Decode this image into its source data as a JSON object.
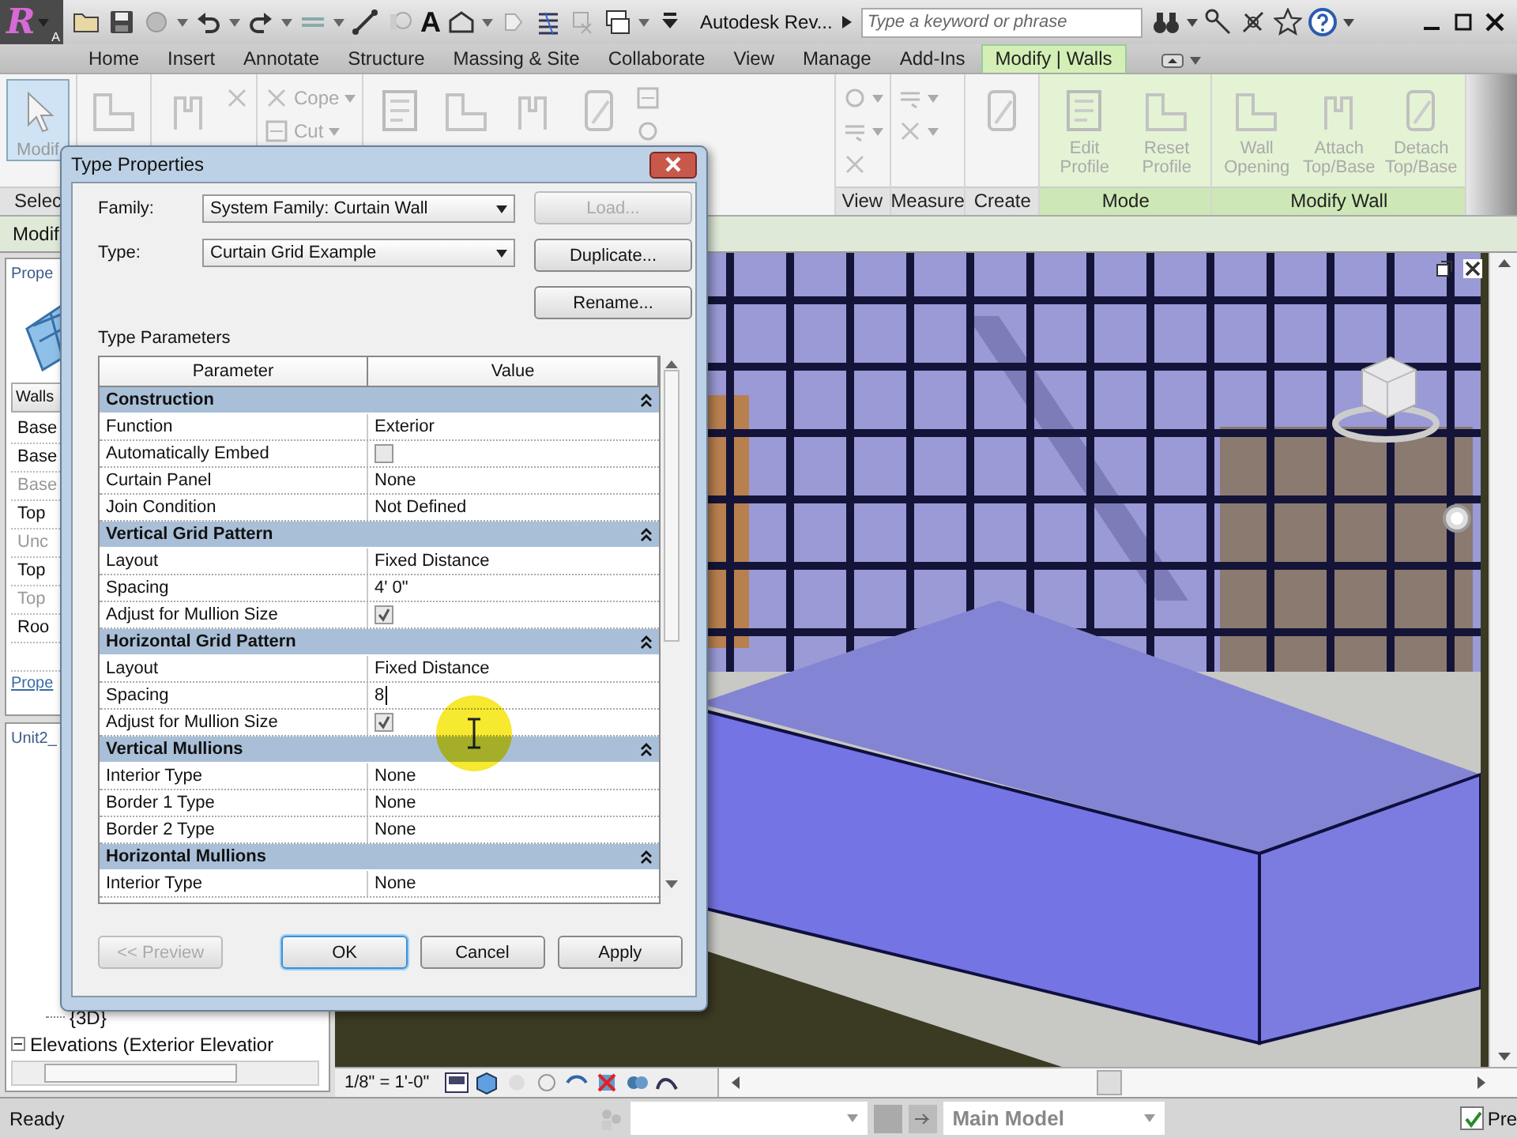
{
  "window": {
    "logo": "R",
    "logo_badge": "A",
    "title": "Autodesk Rev...",
    "search": {
      "placeholder": "Type a keyword or phrase"
    }
  },
  "quick_access": [
    {
      "kind": "open",
      "caret": false
    },
    {
      "kind": "save",
      "caret": false
    },
    {
      "kind": "sync",
      "caret": true
    },
    {
      "kind": "undo",
      "caret": true
    },
    {
      "kind": "redo",
      "caret": true
    },
    {
      "kind": "align",
      "caret": true
    },
    {
      "kind": "dimension",
      "caret": false
    },
    {
      "kind": "tag",
      "caret": false
    },
    {
      "kind": "glyph",
      "label": "A",
      "caret": false
    },
    {
      "kind": "house",
      "caret": true
    },
    {
      "kind": "section",
      "caret": false
    },
    {
      "kind": "thinlines",
      "caret": false
    },
    {
      "kind": "hidden",
      "caret": false
    },
    {
      "kind": "switch",
      "caret": true
    },
    {
      "kind": "customize",
      "caret": false
    }
  ],
  "tabs": [
    {
      "label": "Home",
      "selected": false
    },
    {
      "label": "Insert",
      "selected": false
    },
    {
      "label": "Annotate",
      "selected": false
    },
    {
      "label": "Structure",
      "selected": false
    },
    {
      "label": "Massing & Site",
      "selected": false
    },
    {
      "label": "Collaborate",
      "selected": false
    },
    {
      "label": "View",
      "selected": false
    },
    {
      "label": "Manage",
      "selected": false
    },
    {
      "label": "Add-Ins",
      "selected": false
    },
    {
      "label": "Modify | Walls",
      "selected": true
    }
  ],
  "ribbon": [
    {
      "label": "Selec",
      "contextual": false,
      "tools": [
        {
          "kind": "large",
          "label": "Modif",
          "selected": true
        }
      ]
    },
    {
      "contextual": false,
      "tools": [
        {
          "kind": "large",
          "selected": false
        }
      ]
    },
    {
      "contextual": false,
      "tools": [
        {
          "kind": "large",
          "selected": false
        },
        {
          "kind": "small",
          "caret": false,
          "selected": false
        }
      ]
    },
    {
      "contextual": false,
      "tools": [
        {
          "kind": "small",
          "label": "Cope",
          "caret": true,
          "selected": false
        },
        {
          "kind": "small",
          "label": "Cut",
          "caret": true,
          "selected": false
        }
      ]
    },
    {
      "contextual": false,
      "tools": [
        {
          "kind": "large",
          "selected": false
        },
        {
          "kind": "large",
          "selected": false
        },
        {
          "kind": "large",
          "selected": false
        },
        {
          "kind": "large",
          "selected": false
        },
        {
          "kind": "small",
          "caret": false,
          "selected": false
        },
        {
          "kind": "small",
          "caret": false,
          "selected": false
        }
      ]
    },
    {
      "label": "View",
      "contextual": false,
      "tools": [
        {
          "kind": "small",
          "caret": true,
          "selected": false
        },
        {
          "kind": "small",
          "caret": true,
          "selected": false
        },
        {
          "kind": "small",
          "caret": false,
          "selected": false
        }
      ]
    },
    {
      "label": "Measure",
      "contextual": false,
      "tools": [
        {
          "kind": "small",
          "caret": true,
          "selected": false
        },
        {
          "kind": "small",
          "caret": true,
          "selected": false
        }
      ]
    },
    {
      "label": "Create",
      "contextual": false,
      "tools": [
        {
          "kind": "large",
          "selected": false
        }
      ]
    },
    {
      "label": "Mode",
      "contextual": true,
      "tools": [
        {
          "kind": "large",
          "label": "Edit Profile",
          "selected": false
        },
        {
          "kind": "large",
          "label": "Reset Profile",
          "selected": false
        }
      ]
    },
    {
      "label": "Modify Wall",
      "contextual": true,
      "tools": [
        {
          "kind": "large",
          "label": "Wall Opening",
          "selected": false
        },
        {
          "kind": "large",
          "label": "Attach Top/Base",
          "selected": false
        },
        {
          "kind": "large",
          "label": "Detach Top/Base",
          "selected": false
        }
      ]
    }
  ],
  "options_bar": {
    "label": "Modif"
  },
  "properties_panel": {
    "title": "Prope",
    "type_selector": "Walls",
    "rows": [
      {
        "label": "Base",
        "disabled": false
      },
      {
        "label": "Base",
        "disabled": false
      },
      {
        "label": "Base",
        "disabled": true
      },
      {
        "label": "Top",
        "disabled": false
      },
      {
        "label": "Unc",
        "disabled": true
      },
      {
        "label": "Top",
        "disabled": false
      },
      {
        "label": "Top",
        "disabled": true
      },
      {
        "label": "Roo",
        "disabled": false
      }
    ],
    "link": "Prope"
  },
  "project_browser": {
    "title": "Unit2_",
    "items": [
      {
        "label": "{3D}",
        "expanded": false
      },
      {
        "label": "Elevations (Exterior Elevatior",
        "expanded": true
      }
    ]
  },
  "view_bar": {
    "scale": "1/8\" = 1'-0\""
  },
  "status_bar": {
    "text": "Ready",
    "design_option": "Main Model",
    "press_drag": {
      "label": "Pre",
      "checked": true
    }
  },
  "dialog": {
    "title": "Type Properties",
    "family_label": "Family:",
    "family": "System Family: Curtain Wall",
    "type_label": "Type:",
    "type": "Curtain Grid Example",
    "side_buttons": [
      {
        "label": "Load...",
        "disabled": true
      },
      {
        "label": "Duplicate...",
        "disabled": false
      },
      {
        "label": "Rename...",
        "disabled": false
      }
    ],
    "section_label": "Type Parameters",
    "columns": [
      "Parameter",
      "Value"
    ],
    "groups": [
      {
        "name": "Construction",
        "expanded": true,
        "rows": [
          {
            "parameter": "Function",
            "kind": "text",
            "value": "Exterior"
          },
          {
            "parameter": "Automatically Embed",
            "kind": "check",
            "checked": false
          },
          {
            "parameter": "Curtain Panel",
            "kind": "text",
            "value": "None"
          },
          {
            "parameter": "Join Condition",
            "kind": "text",
            "value": "Not Defined"
          }
        ]
      },
      {
        "name": "Vertical Grid Pattern",
        "expanded": true,
        "rows": [
          {
            "parameter": "Layout",
            "kind": "text",
            "value": "Fixed Distance"
          },
          {
            "parameter": "Spacing",
            "kind": "text",
            "value": "4'  0\""
          },
          {
            "parameter": "Adjust for Mullion Size",
            "kind": "check",
            "checked": true
          }
        ]
      },
      {
        "name": "Horizontal Grid Pattern",
        "expanded": true,
        "rows": [
          {
            "parameter": "Layout",
            "kind": "text",
            "value": "Fixed Distance"
          },
          {
            "parameter": "Spacing",
            "kind": "edit",
            "value": "8"
          },
          {
            "parameter": "Adjust for Mullion Size",
            "kind": "check",
            "checked": true
          }
        ]
      },
      {
        "name": "Vertical Mullions",
        "expanded": true,
        "rows": [
          {
            "parameter": "Interior Type",
            "kind": "text",
            "value": "None"
          },
          {
            "parameter": "Border 1 Type",
            "kind": "text",
            "value": "None"
          },
          {
            "parameter": "Border 2 Type",
            "kind": "text",
            "value": "None"
          }
        ]
      },
      {
        "name": "Horizontal Mullions",
        "expanded": true,
        "rows": [
          {
            "parameter": "Interior Type",
            "kind": "text",
            "value": "None"
          }
        ]
      }
    ],
    "buttons": [
      {
        "label": "<< Preview",
        "disabled": true,
        "default": false
      },
      {
        "label": "OK",
        "disabled": false,
        "default": true
      },
      {
        "label": "Cancel",
        "disabled": false,
        "default": false
      },
      {
        "label": "Apply",
        "disabled": false,
        "default": false
      }
    ]
  }
}
